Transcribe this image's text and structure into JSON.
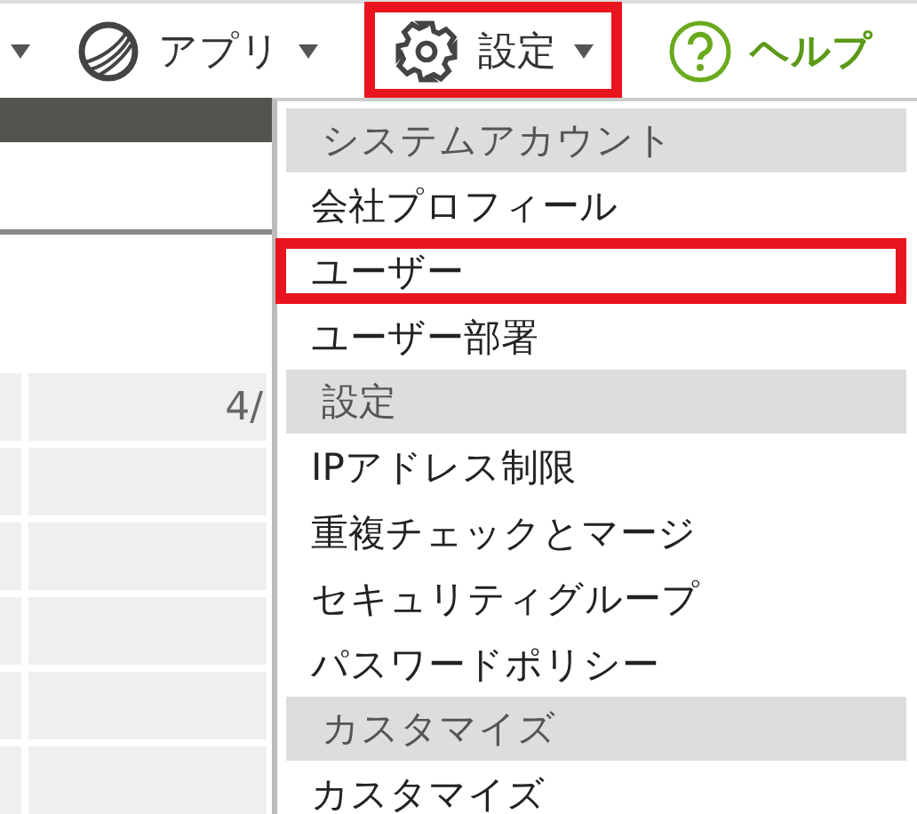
{
  "nav": [
    {
      "kind": "caret"
    },
    {
      "kind": "apps",
      "label": "アプリ",
      "highlighted": false
    },
    {
      "kind": "settings",
      "label": "設定",
      "highlighted": true
    },
    {
      "kind": "help",
      "label": "ヘルプ",
      "highlighted": false
    }
  ],
  "table": {
    "rows": [
      {
        "column_2": "4/"
      },
      {},
      {},
      {},
      {},
      {}
    ]
  },
  "menu": [
    {
      "kind": "header",
      "label": "システムアカウント"
    },
    {
      "kind": "item",
      "label": "会社プロフィール",
      "highlighted": false
    },
    {
      "kind": "item",
      "label": "ユーザー",
      "highlighted": true
    },
    {
      "kind": "item",
      "label": "ユーザー部署",
      "highlighted": false
    },
    {
      "kind": "header",
      "label": "設定"
    },
    {
      "kind": "item",
      "label": "IPアドレス制限",
      "highlighted": false
    },
    {
      "kind": "item",
      "label": "重複チェックとマージ",
      "highlighted": false
    },
    {
      "kind": "item",
      "label": "セキュリティグループ",
      "highlighted": false
    },
    {
      "kind": "item",
      "label": "パスワードポリシー",
      "highlighted": false
    },
    {
      "kind": "header",
      "label": "カスタマイズ"
    },
    {
      "kind": "item",
      "label": "カスタマイズ",
      "highlighted": false
    }
  ]
}
